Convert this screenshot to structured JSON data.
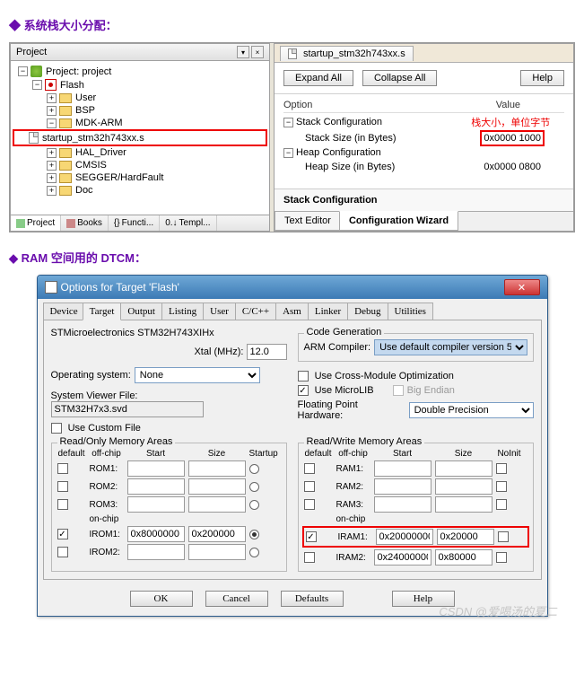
{
  "heading1": "系统栈大小分配：",
  "heading2": "RAM 空间用的 DTCM：",
  "project_panel": {
    "title": "Project",
    "root": "Project: project",
    "target": "Flash",
    "groups": [
      "User",
      "BSP",
      "MDK-ARM",
      "HAL_Driver",
      "CMSIS",
      "SEGGER/HardFault",
      "Doc"
    ],
    "startup_file": "startup_stm32h743xx.s",
    "bottom_tabs": [
      "Project",
      "Books",
      "Functi...",
      "Templ..."
    ],
    "funcs_prefix": "{}",
    "templ_prefix": "0.↓"
  },
  "config_panel": {
    "file_tab": "startup_stm32h743xx.s",
    "expand": "Expand All",
    "collapse": "Collapse All",
    "help": "Help",
    "col_option": "Option",
    "col_value": "Value",
    "stack_cfg": "Stack Configuration",
    "stack_size_label": "Stack Size (in Bytes)",
    "stack_size_value": "0x0000 1000",
    "stack_annotation": "栈大小，单位字节",
    "heap_cfg": "Heap Configuration",
    "heap_size_label": "Heap Size (in Bytes)",
    "heap_size_value": "0x0000 0800",
    "section_title": "Stack Configuration",
    "editor_tabs": [
      "Text Editor",
      "Configuration Wizard"
    ]
  },
  "dialog": {
    "title": "Options for Target 'Flash'",
    "tabs": [
      "Device",
      "Target",
      "Output",
      "Listing",
      "User",
      "C/C++",
      "Asm",
      "Linker",
      "Debug",
      "Utilities"
    ],
    "chip": "STMicroelectronics STM32H743XIHx",
    "xtal_label": "Xtal (MHz):",
    "xtal_value": "12.0",
    "os_label": "Operating system:",
    "os_value": "None",
    "svf_label": "System Viewer File:",
    "svf_value": "STM32H7x3.svd",
    "custom_file": "Use Custom File",
    "codegen": "Code Generation",
    "arm_compiler": "ARM Compiler:",
    "arm_compiler_val": "Use default compiler version 5",
    "cross_module": "Use Cross-Module Optimization",
    "microlib": "Use MicroLIB",
    "big_endian": "Big Endian",
    "fp_hw": "Floating Point Hardware:",
    "fp_val": "Double Precision",
    "ro_legend": "Read/Only Memory Areas",
    "rw_legend": "Read/Write Memory Areas",
    "hdr_default": "default",
    "hdr_offchip": "off-chip",
    "hdr_start": "Start",
    "hdr_size": "Size",
    "hdr_startup": "Startup",
    "hdr_noinit": "NoInit",
    "onchip": "on-chip",
    "rom_labels": [
      "ROM1:",
      "ROM2:",
      "ROM3:",
      "IROM1:",
      "IROM2:"
    ],
    "ram_labels": [
      "RAM1:",
      "RAM2:",
      "RAM3:",
      "IRAM1:",
      "IRAM2:"
    ],
    "irom1_start": "0x8000000",
    "irom1_size": "0x200000",
    "iram1_start": "0x20000000",
    "iram1_size": "0x20000",
    "iram2_start": "0x24000000",
    "iram2_size": "0x80000",
    "ok": "OK",
    "cancel": "Cancel",
    "defaults": "Defaults",
    "dlg_help": "Help"
  },
  "watermark": "CSDN @爱喝汤的夏二"
}
